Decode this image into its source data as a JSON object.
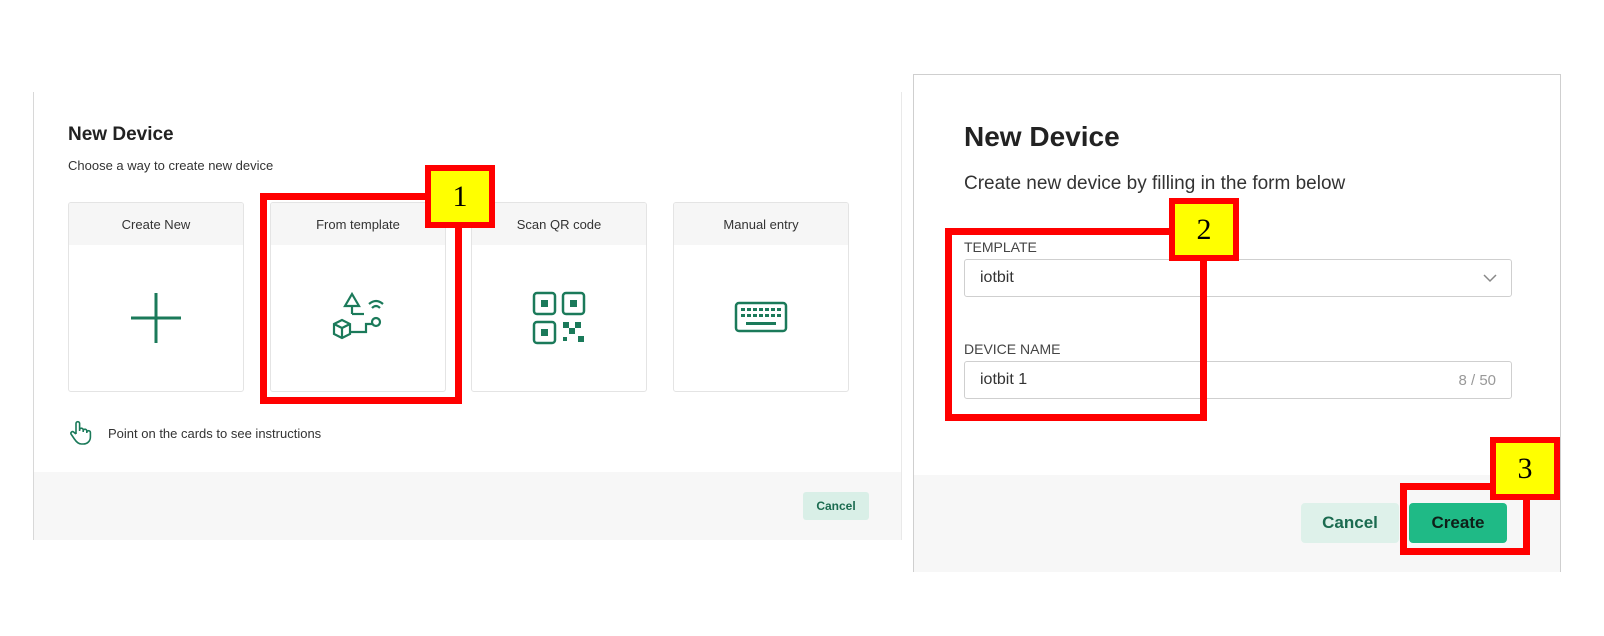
{
  "left_dialog": {
    "title": "New Device",
    "subtitle": "Choose a way to create new device",
    "cards": [
      {
        "label": "Create New",
        "icon": "plus-icon"
      },
      {
        "label": "From template",
        "icon": "template-icon"
      },
      {
        "label": "Scan QR code",
        "icon": "qr-code-icon"
      },
      {
        "label": "Manual entry",
        "icon": "keyboard-icon"
      }
    ],
    "hint": "Point on the cards to see instructions",
    "cancel_label": "Cancel"
  },
  "right_dialog": {
    "title": "New Device",
    "subtitle": "Create new device by filling in the form below",
    "template_label": "TEMPLATE",
    "template_value": "iotbit",
    "device_name_label": "DEVICE NAME",
    "device_name_value": "iotbit 1",
    "device_name_counter": "8 / 50",
    "cancel_label": "Cancel",
    "create_label": "Create"
  },
  "annotations": [
    "1",
    "2",
    "3"
  ],
  "colors": {
    "accent": "#1fba86",
    "icon_green": "#1b7a5a",
    "highlight": "#ff0000",
    "badge": "#ffff00"
  }
}
